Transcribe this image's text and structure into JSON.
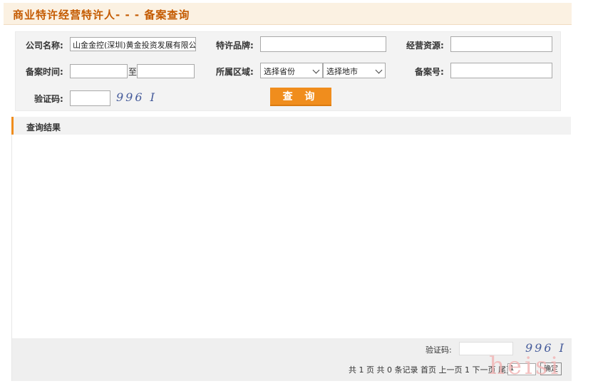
{
  "page": {
    "title": "商业特许经营特许人- - - 备案查询"
  },
  "form": {
    "company_label": "公司名称:",
    "company_value": "山金金控(深圳)黄金投资发展有限公司",
    "brand_label": "特许品牌:",
    "brand_value": "",
    "resource_label": "经营资源:",
    "resource_value": "",
    "record_time_label": "备案时间:",
    "date_from": "",
    "date_sep": "至",
    "date_to": "",
    "region_label": "所属区域:",
    "province_select": "选择省份",
    "city_select": "选择地市",
    "record_no_label": "备案号:",
    "record_no_value": "",
    "captcha_label": "验证码:",
    "captcha_value": "",
    "captcha_image_text": "996 I",
    "query_button": "查 询"
  },
  "results": {
    "title": "查询结果"
  },
  "footer": {
    "captcha_label": "验证码:",
    "captcha_image_text": "996 I",
    "pagination_text": "共 1 页 共 0 条记录 首页 上一页 1 下一页 尾页",
    "page_input_value": "1",
    "confirm_button": "确定"
  },
  "watermark": "heisi",
  "colors": {
    "accent": "#f08d1d",
    "title": "#c45a00"
  }
}
